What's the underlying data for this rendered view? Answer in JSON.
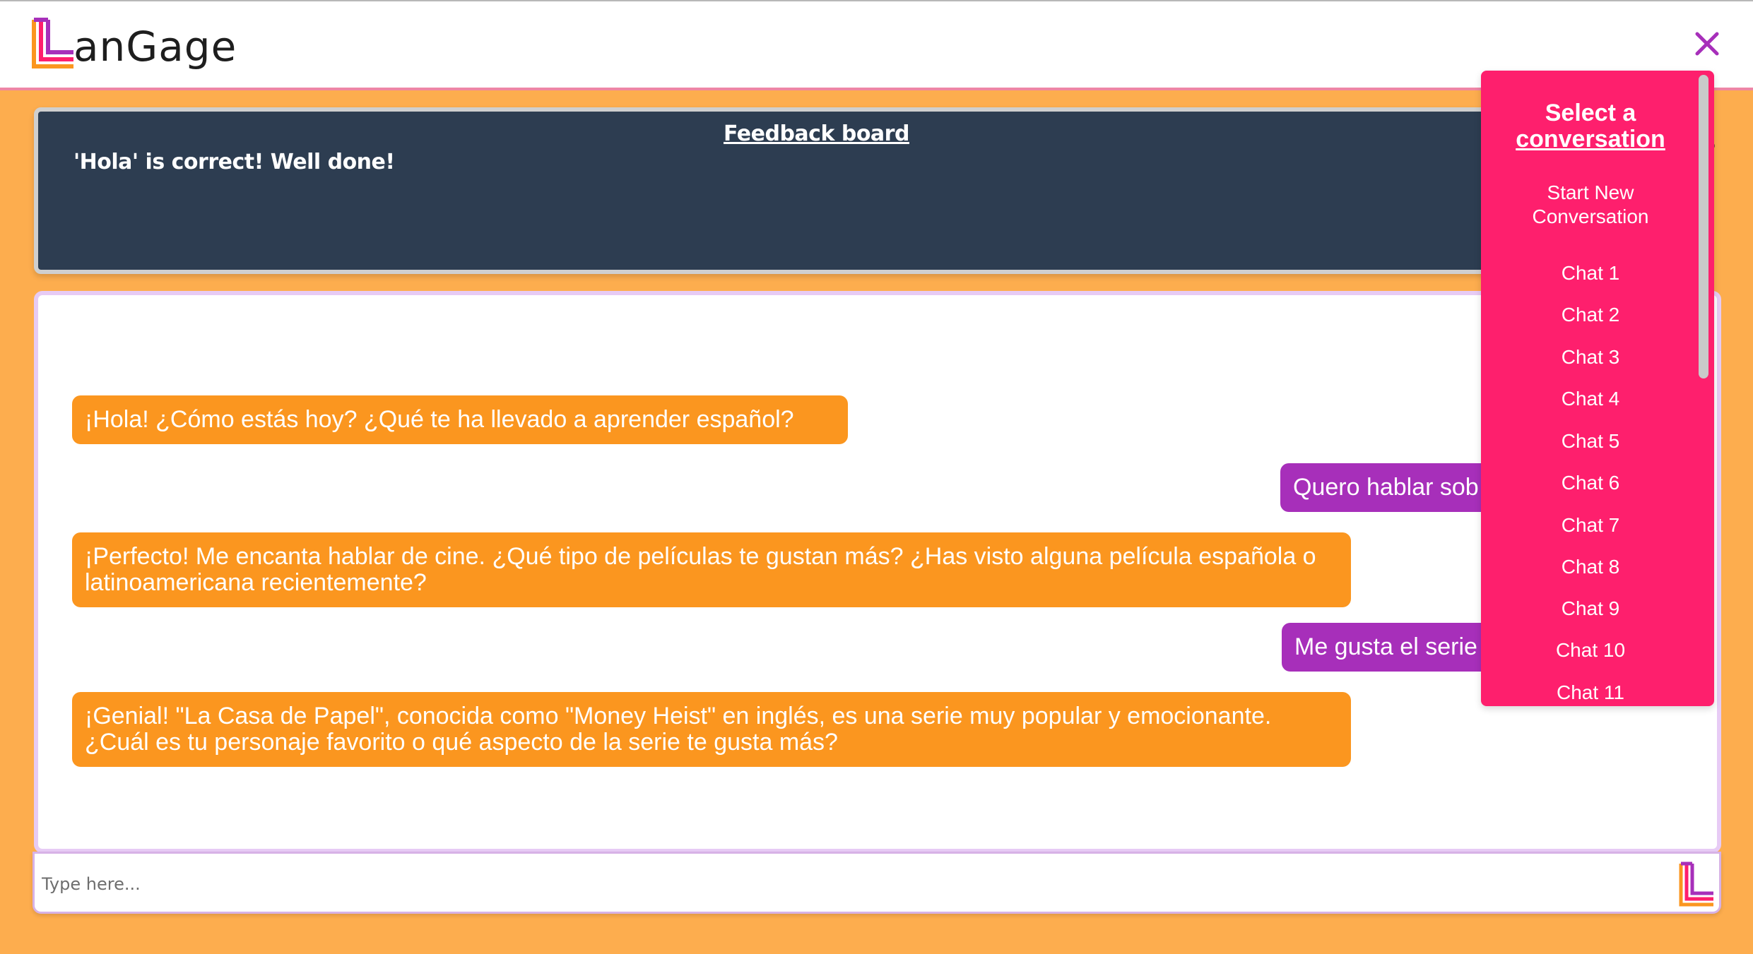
{
  "app": {
    "brand": "anGage"
  },
  "feedback": {
    "title": "Feedback board",
    "message": "'Hola' is correct! Well done!",
    "extra": "?"
  },
  "messages": [
    {
      "role": "bot",
      "text": "¡Hola! ¿Cómo estás hoy? ¿Qué te ha llevado a aprender español?"
    },
    {
      "role": "user",
      "text": "Quero hablar sob"
    },
    {
      "role": "bot",
      "text": "¡Perfecto! Me encanta hablar de cine. ¿Qué tipo de películas te gustan más? ¿Has visto alguna película española o latinoamericana recientemente?"
    },
    {
      "role": "user",
      "text": "Me gusta el serie"
    },
    {
      "role": "bot",
      "text": "¡Genial! \"La Casa de Papel\", conocida como \"Money Heist\" en inglés, es una serie muy popular y emocionante. ¿Cuál es tu personaje favorito o qué aspecto de la serie te gusta más?"
    }
  ],
  "input": {
    "placeholder": "Type here..."
  },
  "menu": {
    "title_line1": "Select a",
    "title_line2": "conversation",
    "new_label": "Start New Conversation",
    "items": [
      "Chat 1",
      "Chat 2",
      "Chat 3",
      "Chat 4",
      "Chat 5",
      "Chat 6",
      "Chat 7",
      "Chat 8",
      "Chat 9",
      "Chat 10",
      "Chat 11"
    ]
  },
  "colors": {
    "background": "#fdad4e",
    "bot_bubble": "#fb961f",
    "user_bubble": "#a72fba",
    "menu": "#fe1f6d",
    "feedback_board": "#2d3d51",
    "close_icon": "#a72fba"
  },
  "icons": [
    "langage-logo-icon",
    "close-icon",
    "send-logo-icon"
  ]
}
